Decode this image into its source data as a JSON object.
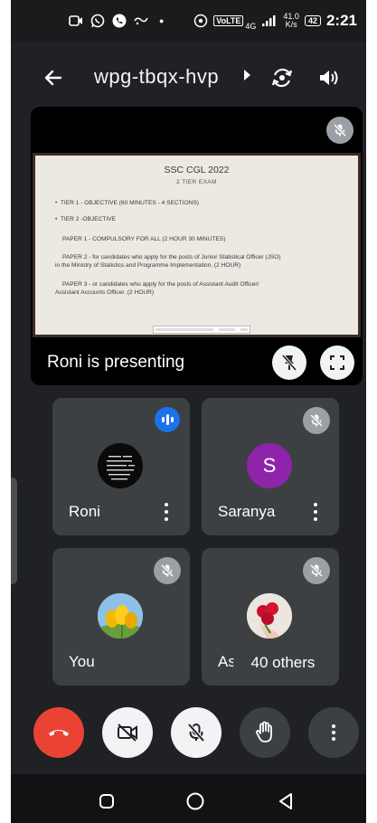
{
  "status_bar": {
    "network_badge": "VoLTE",
    "network_gen": "4G",
    "speed_value": "41.0",
    "speed_unit": "K/s",
    "battery": "42",
    "time": "2:21",
    "icons": [
      "video-call-icon",
      "whatsapp-icon",
      "phone-icon",
      "app-icon",
      "dot-icon",
      "hotspot-icon",
      "signal-icon"
    ]
  },
  "top_bar": {
    "meeting_code": "wpg-tbqx-hvp",
    "icons": [
      "back-arrow-icon",
      "chevron-right-icon",
      "switch-camera-icon",
      "speaker-icon"
    ]
  },
  "presentation": {
    "label": "Roni is presenting",
    "slide": {
      "title": "SSC CGL 2022",
      "subtitle": "2 TIER EXAM",
      "lines": [
        "TIER 1 - OBJECTIVE (60 MINUTES - 4 SECTIONS)",
        "TIER 2 -OBJECTIVE",
        "PAPER 1 - COMPULSORY FOR ALL (2 HOUR 30 MINUTES)",
        "PAPER 2 - for candidates who apply for the posts of Junior Statistical Officer (JSO)",
        "in the Ministry of Statistics and Programme Implementation. (2 HOUR)",
        "PAPER 3 - or candidates who apply for the posts of Assistant Audit Officer/",
        "Assistant Accounts Officer. (2 HOUR)"
      ]
    }
  },
  "participants": [
    {
      "name": "Roni",
      "status": "speaking"
    },
    {
      "name": "Saranya",
      "avatar_letter": "S",
      "avatar_color": "#8e24aa",
      "status": "muted"
    },
    {
      "name": "You",
      "status": "muted"
    },
    {
      "name": "Ash",
      "status": "muted"
    }
  ],
  "others_count": "40 others",
  "controls": [
    "end-call-icon",
    "camera-off-icon",
    "mic-off-icon",
    "raise-hand-icon",
    "more-options-icon"
  ],
  "colors": {
    "background": "#202124",
    "tile": "#3c4043",
    "end_call": "#ea4335",
    "speaking": "#1a73e8"
  }
}
